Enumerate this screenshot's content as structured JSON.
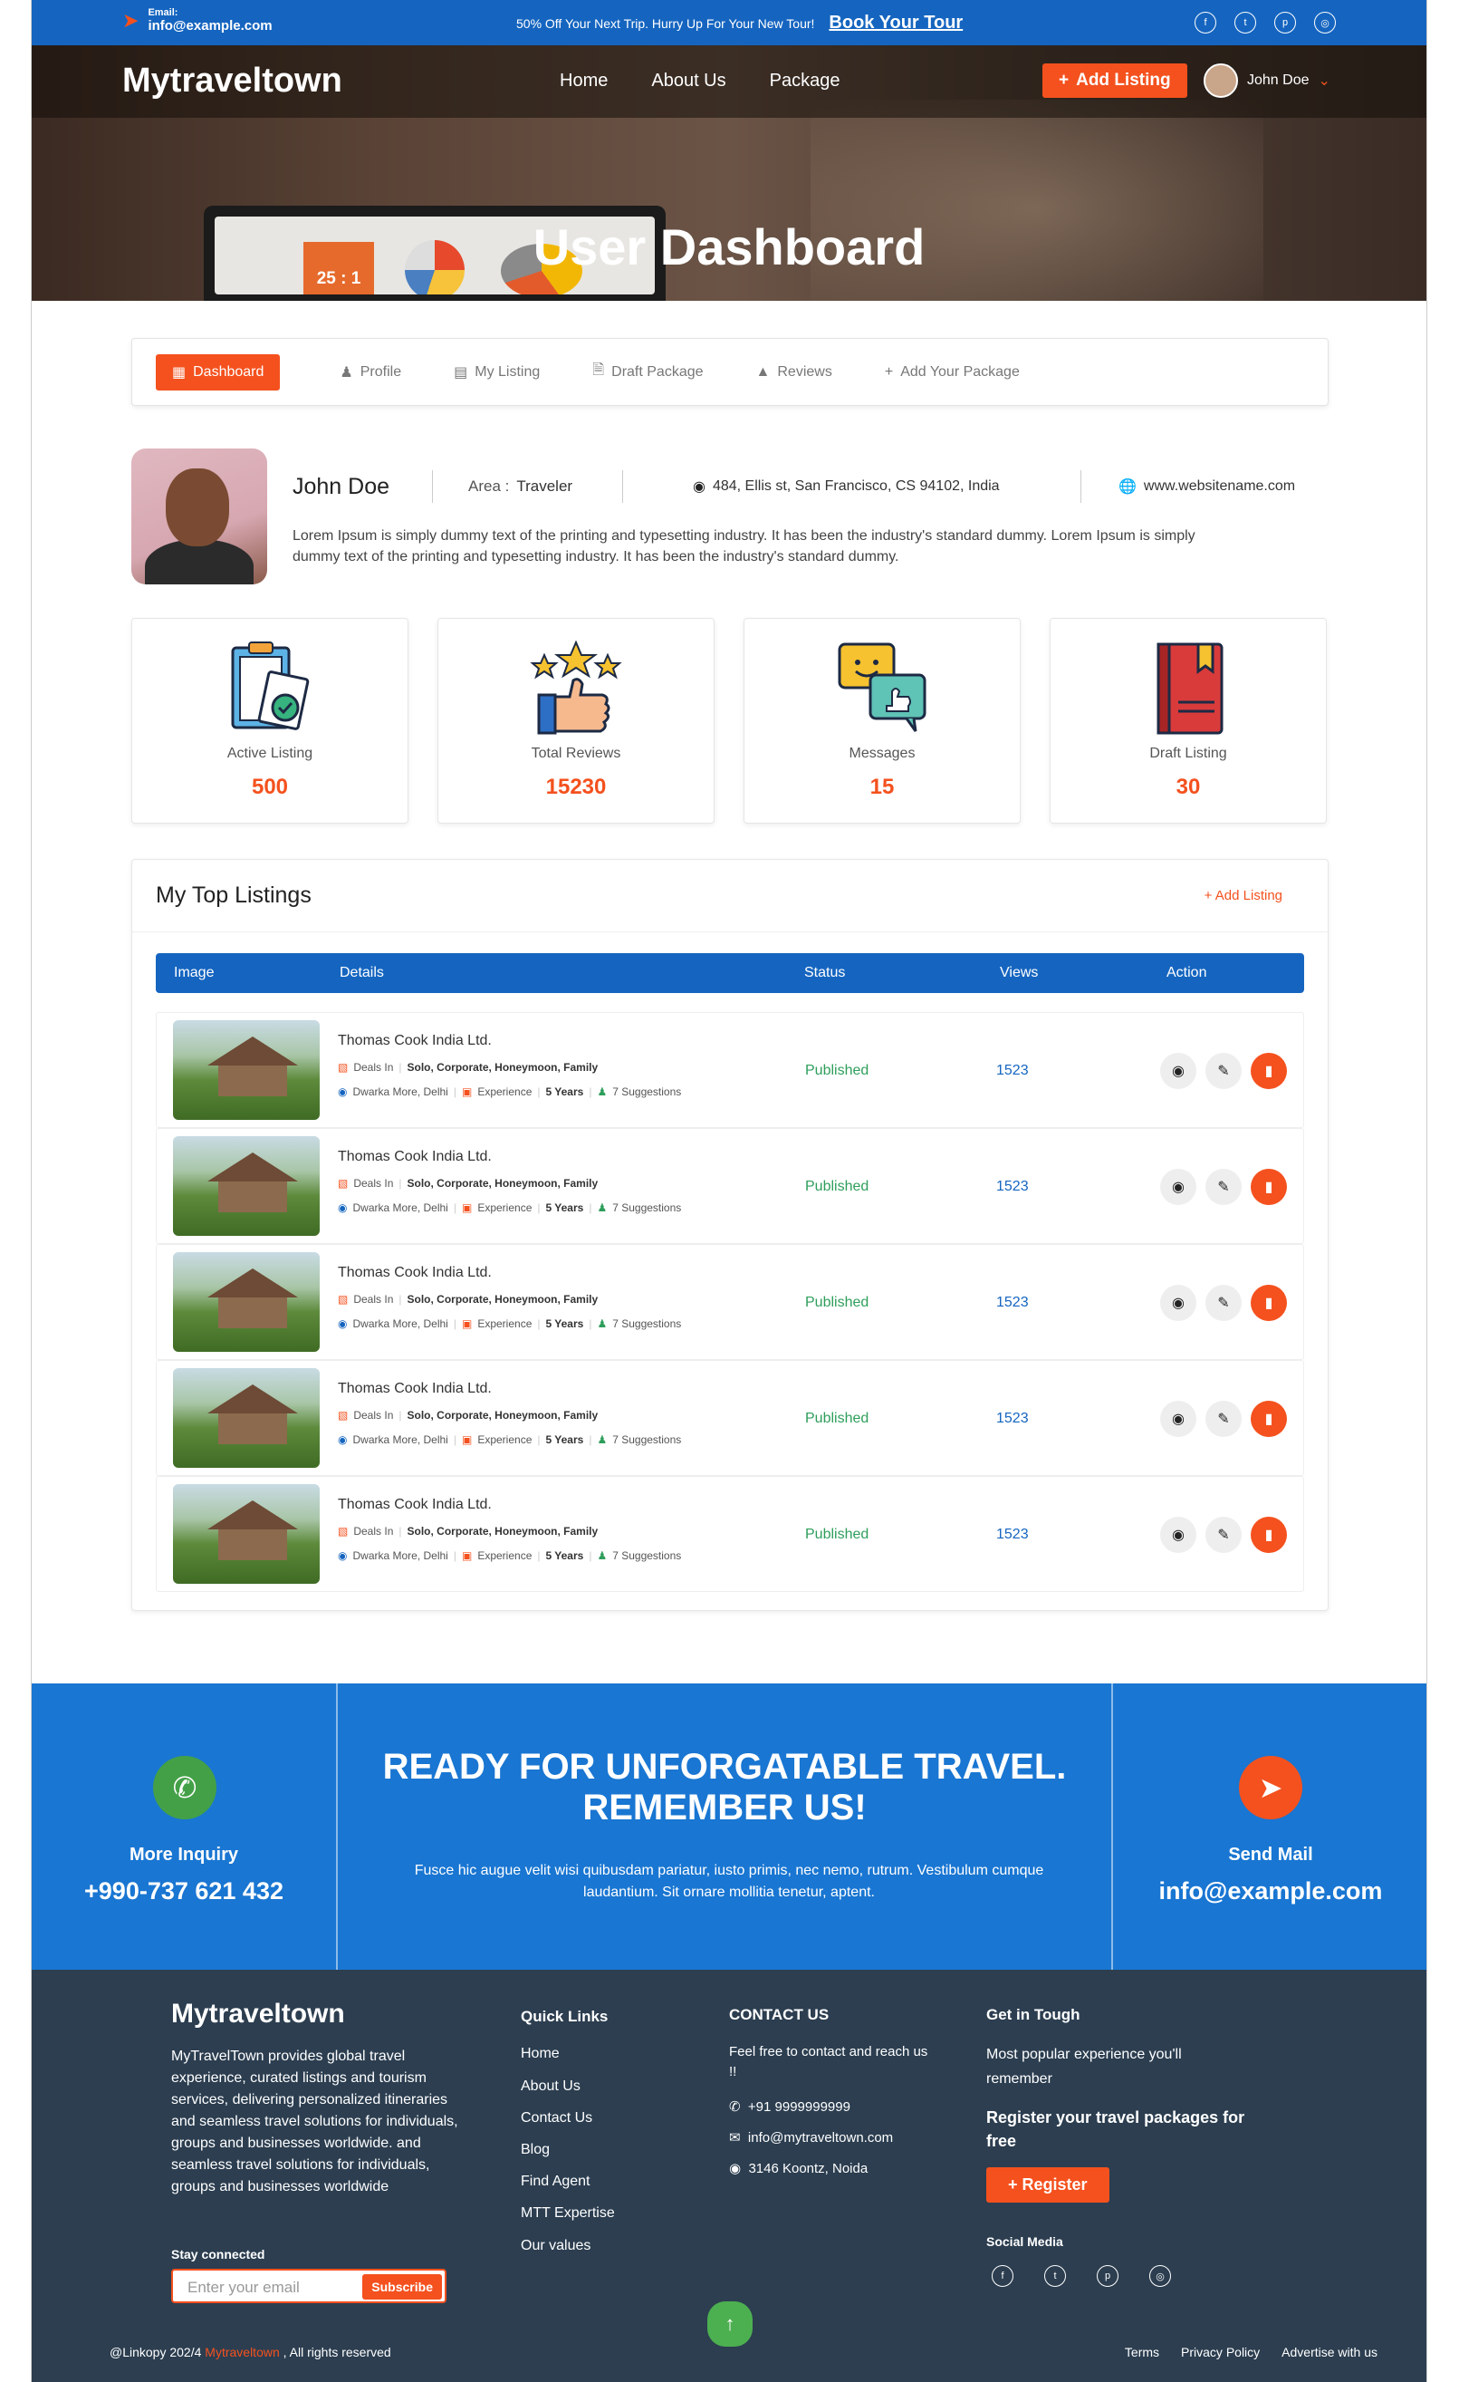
{
  "topbar": {
    "email_label": "Email:",
    "email": "info@example.com",
    "promo": "50% Off Your Next Trip. Hurry Up For Your New Tour!",
    "promo_link": "Book Your Tour"
  },
  "nav": {
    "logo": "Mytraveltown",
    "menu": [
      "Home",
      "About Us",
      "Package"
    ],
    "add_listing": "Add Listing",
    "user": "John Doe"
  },
  "hero": {
    "title": "User Dashboard",
    "laptop_ratio": "25 : 1"
  },
  "tabs": [
    "Dashboard",
    "Profile",
    "My Listing",
    "Draft Package",
    "Reviews",
    "Add Your Package"
  ],
  "profile": {
    "name": "John Doe",
    "area_label": "Area :",
    "area": "Traveler",
    "address": "484, Ellis st, San Francisco, CS 94102, India",
    "website": "www.websitename.com",
    "description": "Lorem Ipsum is simply dummy text of the printing and typesetting industry. It has been the industry's standard dummy. Lorem Ipsum is simply dummy text of the printing and typesetting industry. It has been the industry's standard dummy."
  },
  "stats": [
    {
      "label": "Active Listing",
      "value": "500",
      "icon": "clipboard-check-icon"
    },
    {
      "label": "Total Reviews",
      "value": "15230",
      "icon": "stars-thumbs-up-icon"
    },
    {
      "label": "Messages",
      "value": "15",
      "icon": "chat-bubbles-icon"
    },
    {
      "label": "Draft Listing",
      "value": "30",
      "icon": "book-bookmark-icon"
    }
  ],
  "listings": {
    "title": "My Top Listings",
    "add_label": "Add Listing",
    "columns": [
      "Image",
      "Details",
      "Status",
      "Views",
      "Action"
    ],
    "rows": [
      {
        "title": "Thomas Cook India Ltd.",
        "deals_label": "Deals In",
        "deals": "Solo, Corporate, Honeymoon, Family",
        "location": "Dwarka More, Delhi",
        "exp_label": "Experience",
        "exp": "5 Years",
        "suggestions": "7 Suggestions",
        "status": "Published",
        "views": "1523"
      },
      {
        "title": "Thomas Cook India Ltd.",
        "deals_label": "Deals In",
        "deals": "Solo, Corporate, Honeymoon, Family",
        "location": "Dwarka More, Delhi",
        "exp_label": "Experience",
        "exp": "5 Years",
        "suggestions": "7 Suggestions",
        "status": "Published",
        "views": "1523"
      },
      {
        "title": "Thomas Cook India Ltd.",
        "deals_label": "Deals In",
        "deals": "Solo, Corporate, Honeymoon, Family",
        "location": "Dwarka More, Delhi",
        "exp_label": "Experience",
        "exp": "5 Years",
        "suggestions": "7 Suggestions",
        "status": "Published",
        "views": "1523"
      },
      {
        "title": "Thomas Cook India Ltd.",
        "deals_label": "Deals In",
        "deals": "Solo, Corporate, Honeymoon, Family",
        "location": "Dwarka More, Delhi",
        "exp_label": "Experience",
        "exp": "5 Years",
        "suggestions": "7 Suggestions",
        "status": "Published",
        "views": "1523"
      },
      {
        "title": "Thomas Cook India Ltd.",
        "deals_label": "Deals In",
        "deals": "Solo, Corporate, Honeymoon, Family",
        "location": "Dwarka More, Delhi",
        "exp_label": "Experience",
        "exp": "5 Years",
        "suggestions": "7 Suggestions",
        "status": "Published",
        "views": "1523"
      }
    ]
  },
  "cta": {
    "inquiry_label": "More Inquiry",
    "phone": "+990-737 621 432",
    "heading": "READY FOR UNFORGATABLE TRAVEL. REMEMBER US!",
    "text": "Fusce hic augue velit wisi quibusdam pariatur, iusto primis, nec nemo, rutrum. Vestibulum cumque laudantium. Sit ornare mollitia tenetur, aptent.",
    "mail_label": "Send Mail",
    "mail": "info@example.com"
  },
  "footer": {
    "logo": "Mytraveltown",
    "description": "MyTravelTown provides global travel experience, curated listings and tourism services, delivering personalized itineraries and seamless travel solutions for individuals, groups and businesses worldwide.  and seamless travel solutions for individuals, groups and businesses worldwide",
    "stay_connected": "Stay connected",
    "email_placeholder": "Enter your email",
    "subscribe": "Subscribe",
    "quick_links_title": "Quick Links",
    "quick_links": [
      "Home",
      "About Us",
      "Contact Us",
      "Blog",
      "Find Agent",
      "MTT Expertise",
      "Our values"
    ],
    "contact_title": "CONTACT US",
    "contact_text": "Feel free to contact and reach us !!",
    "phone": "+91 9999999999",
    "email": "info@mytraveltown.com",
    "address": "3146 Koontz, Noida",
    "touch_title": "Get in Tough",
    "touch_text": "Most popular experience you'll remember",
    "register_text": "Register your travel packages for free",
    "register": "Register",
    "social_title": "Social Media",
    "copyright_prefix": "@Linkopy 202/4",
    "copyright_brand": "Mytraveltown",
    "copyright_suffix": ", All rights reserved",
    "bottom_links": [
      "Terms",
      "Privacy Policy",
      "Advertise with us"
    ]
  },
  "colors": {
    "accent": "#f4511e",
    "primary": "#1565c0",
    "footer": "#2c3e50",
    "success": "#2e9e5b"
  }
}
